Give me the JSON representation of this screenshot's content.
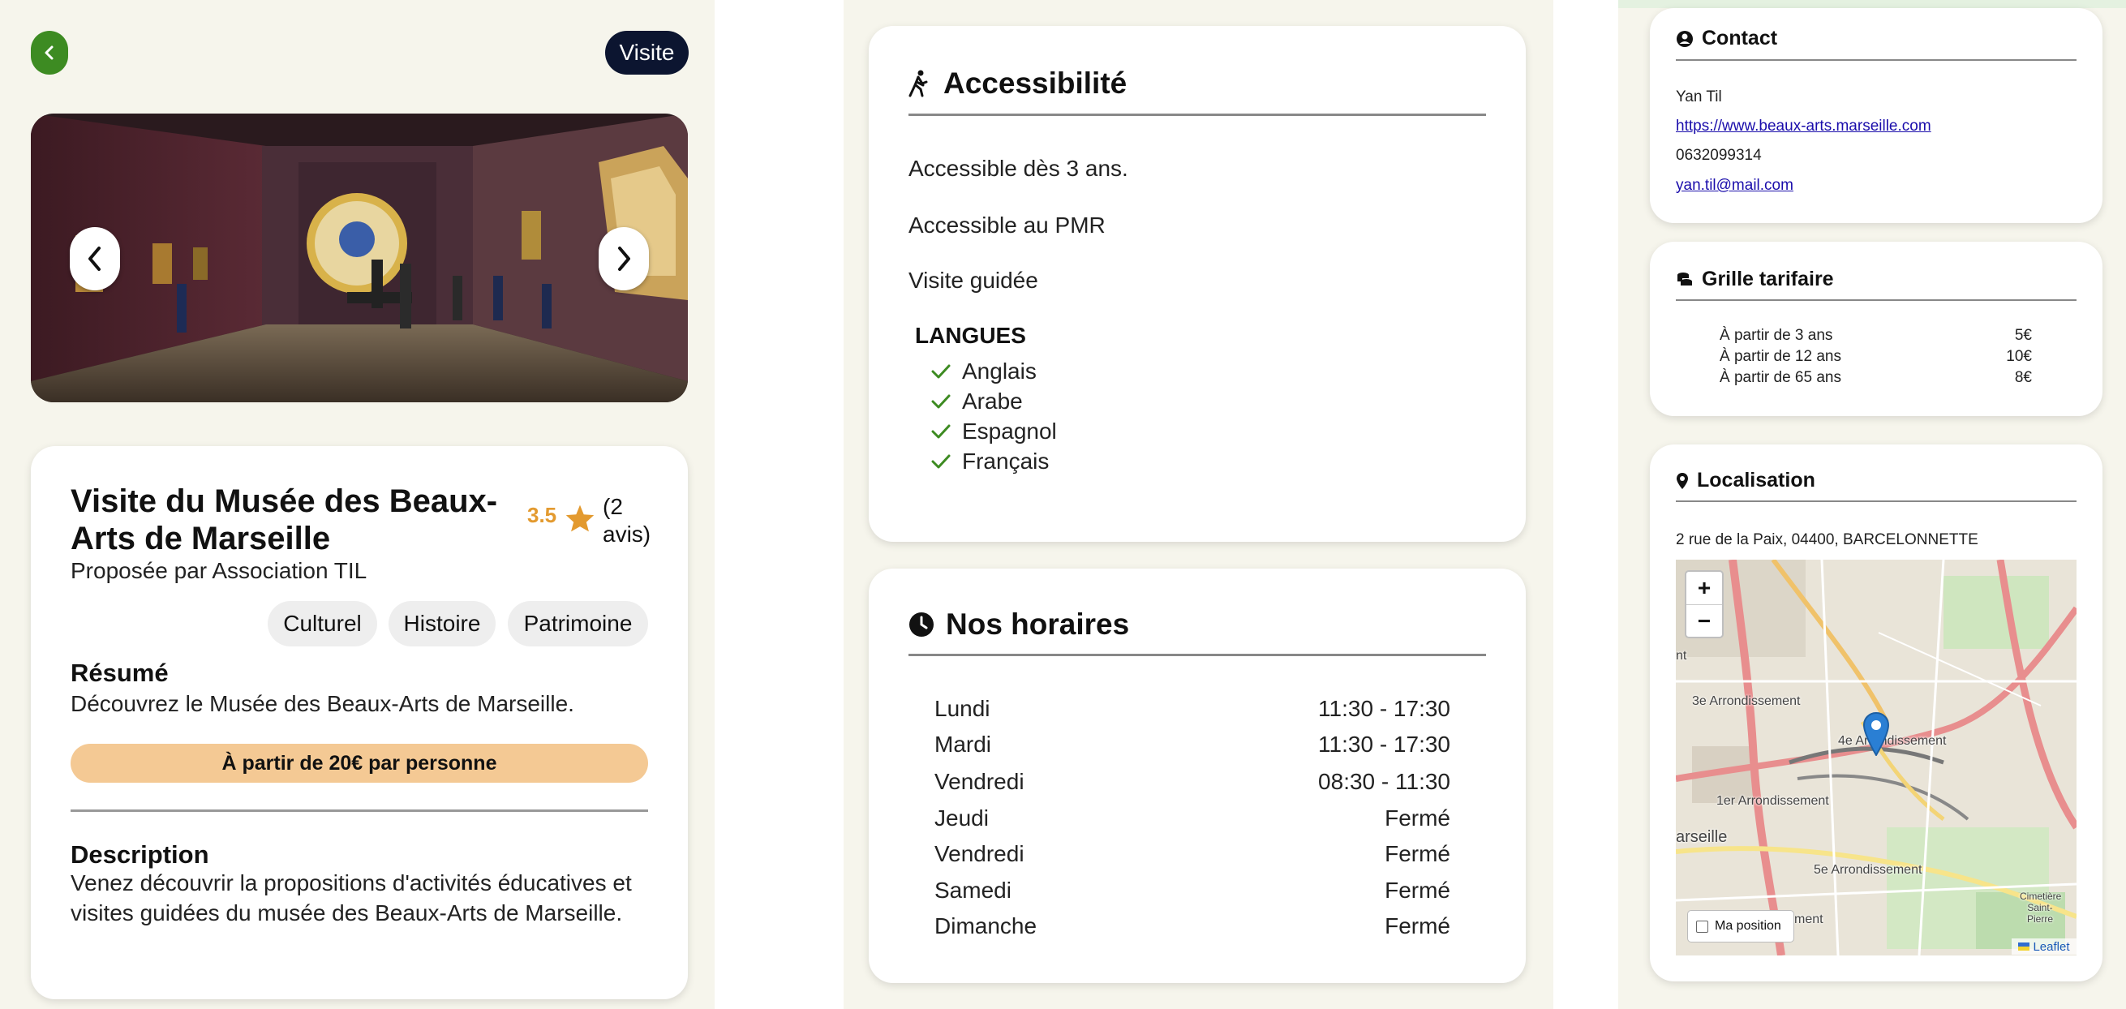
{
  "header": {
    "type_badge": "Visite"
  },
  "activity": {
    "title": "Visite du Musée des Beaux-Arts de Marseille",
    "rating": "3.5",
    "reviews": "(2 avis)",
    "provider": "Proposée par Association TIL",
    "tags": [
      "Culturel",
      "Histoire",
      "Patrimoine"
    ],
    "summary_heading": "Résumé",
    "summary": "Découvrez le Musée des Beaux-Arts de Marseille.",
    "price_label": "À partir de 20€ par personne",
    "description_heading": "Description",
    "description": "Venez découvrir la propositions d'activités éducatives et visites guidées du musée des Beaux-Arts de Marseille."
  },
  "accessibility": {
    "heading": "Accessibilité",
    "items": [
      "Accessible dès 3 ans.",
      "Accessible au PMR",
      "Visite guidée"
    ],
    "languages_heading": "LANGUES",
    "languages": [
      "Anglais",
      "Arabe",
      "Espagnol",
      "Français"
    ]
  },
  "hours": {
    "heading": "Nos horaires",
    "rows": [
      {
        "day": "Lundi",
        "time": "11:30 - 17:30"
      },
      {
        "day": "Mardi",
        "time": "11:30 - 17:30"
      },
      {
        "day": "Vendredi",
        "time": "08:30 - 11:30"
      },
      {
        "day": "Jeudi",
        "time": "Fermé"
      },
      {
        "day": "Vendredi",
        "time": "Fermé"
      },
      {
        "day": "Samedi",
        "time": "Fermé"
      },
      {
        "day": "Dimanche",
        "time": "Fermé"
      }
    ]
  },
  "contact": {
    "heading": "Contact",
    "name": "Yan Til",
    "website": "https://www.beaux-arts.marseille.com",
    "phone": "0632099314",
    "email": "yan.til@mail.com"
  },
  "pricing": {
    "heading": "Grille tarifaire",
    "rows": [
      {
        "label": "À partir de 3 ans",
        "price": "5€"
      },
      {
        "label": "À partir de 12 ans",
        "price": "10€"
      },
      {
        "label": "À partir de 65 ans",
        "price": "8€"
      }
    ]
  },
  "location": {
    "heading": "Localisation",
    "address": "2 rue de la Paix, 04400, BARCELONNETTE",
    "zoom_in": "+",
    "zoom_out": "−",
    "my_position": "Ma position",
    "attribution": "Leaflet",
    "map_labels": [
      "3e Arrondissement",
      "4e Arrondissement",
      "1er Arrondissement",
      "5e Arrondissement",
      "arseille",
      "nt",
      "ment",
      "Cimetière Saint-Pierre"
    ]
  },
  "colors": {
    "accent_green": "#3d8b22",
    "price_pill": "#f4c994",
    "rating": "#e39a2f",
    "badge": "#0c1530",
    "marker": "#2a7fd4"
  }
}
